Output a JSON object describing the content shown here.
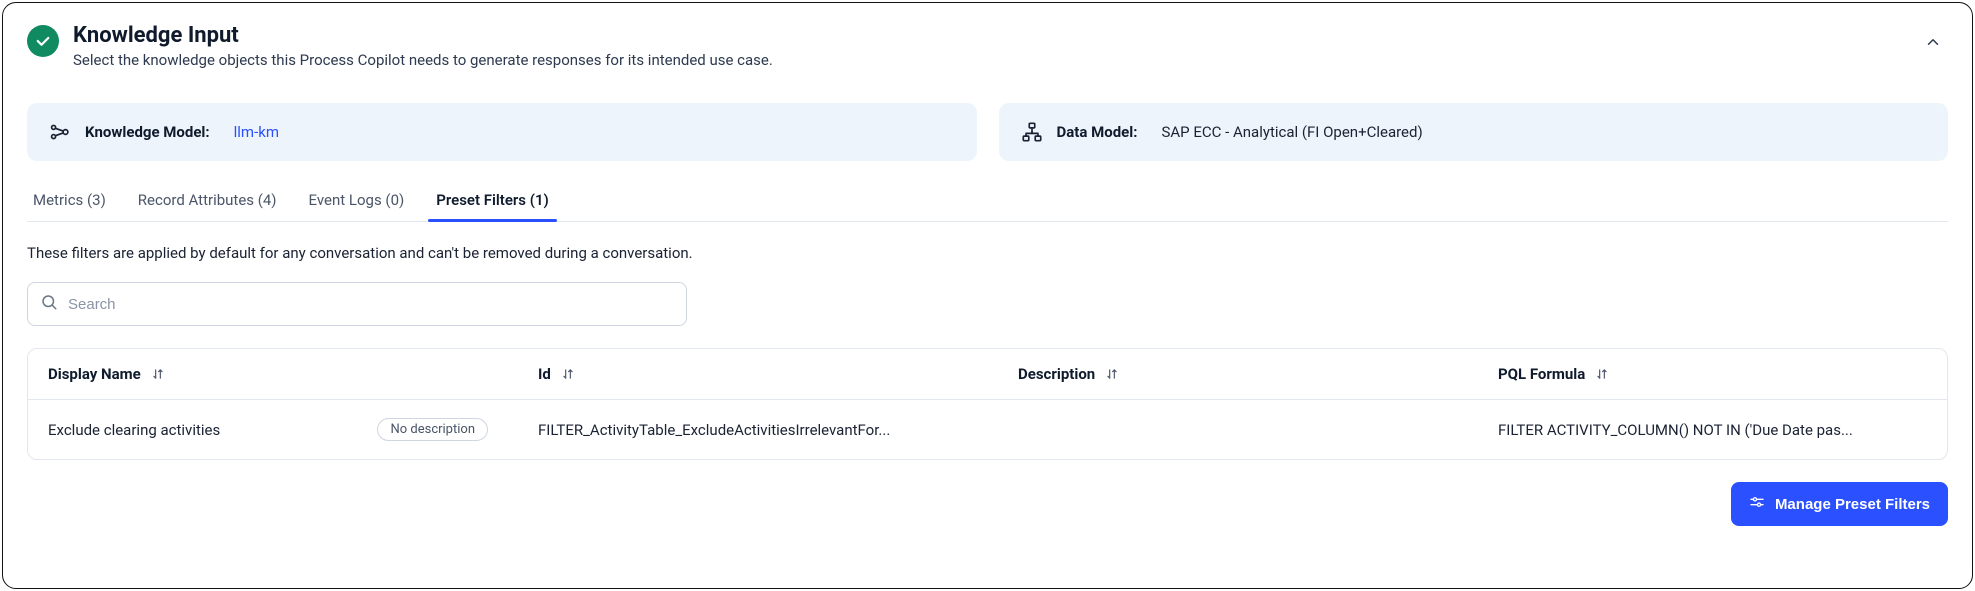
{
  "header": {
    "title": "Knowledge Input",
    "subtitle": "Select the knowledge objects this Process Copilot needs to generate responses for its intended use case."
  },
  "cards": {
    "knowledge_model": {
      "label": "Knowledge Model:",
      "value": "llm-km"
    },
    "data_model": {
      "label": "Data Model:",
      "value": "SAP ECC - Analytical (FI Open+Cleared)"
    }
  },
  "tabs": {
    "metrics": "Metrics (3)",
    "record_attributes": "Record Attributes (4)",
    "event_logs": "Event Logs (0)",
    "preset_filters": "Preset Filters (1)"
  },
  "tab_description": "These filters are applied by default for any conversation and can't be removed during a conversation.",
  "search": {
    "placeholder": "Search"
  },
  "table": {
    "headers": {
      "display_name": "Display Name",
      "id": "Id",
      "description": "Description",
      "pql_formula": "PQL Formula"
    },
    "rows": [
      {
        "display_name": "Exclude clearing activities",
        "no_description_badge": "No description",
        "id": "FILTER_ActivityTable_ExcludeActivitiesIrrelevantFor...",
        "description": "",
        "pql_formula": "FILTER ACTIVITY_COLUMN() NOT IN ('Due Date pas..."
      }
    ]
  },
  "footer": {
    "manage_button": "Manage Preset Filters"
  }
}
